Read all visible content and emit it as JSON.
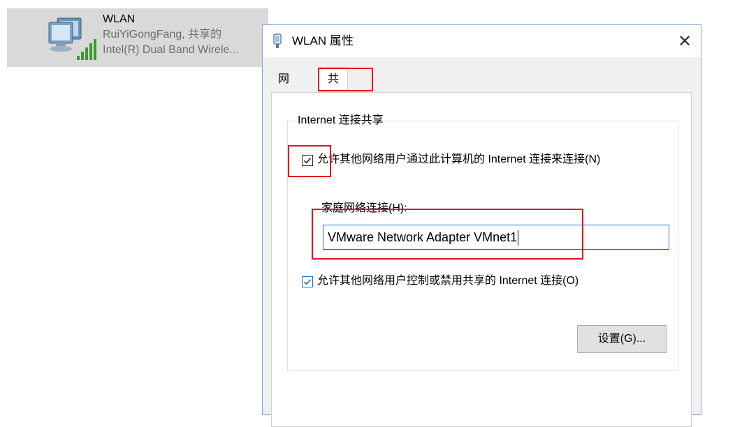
{
  "connection": {
    "name": "WLAN",
    "network": "RuiYiGongFang, 共享的",
    "adapter": "Intel(R) Dual Band Wirele..."
  },
  "dialog": {
    "title": "WLAN 属性",
    "close_glyph": "✕",
    "tabs": [
      "网络",
      "共享"
    ],
    "group_title": "Internet 连接共享",
    "allow_connect_label": "允许其他网络用户通过此计算机的 Internet 连接来连接(N)",
    "allow_connect_checked": true,
    "home_network_label": "家庭网络连接(H):",
    "home_network_value": "VMware Network Adapter VMnet1",
    "allow_control_label": "允许其他网络用户控制或禁用共享的 Internet 连接(O)",
    "allow_control_checked": true,
    "settings_button": "设置(G)..."
  },
  "colors": {
    "highlight_box": "#e0141e",
    "input_border": "#1c6fd1",
    "titlebar_border": "#7aa7d6"
  }
}
